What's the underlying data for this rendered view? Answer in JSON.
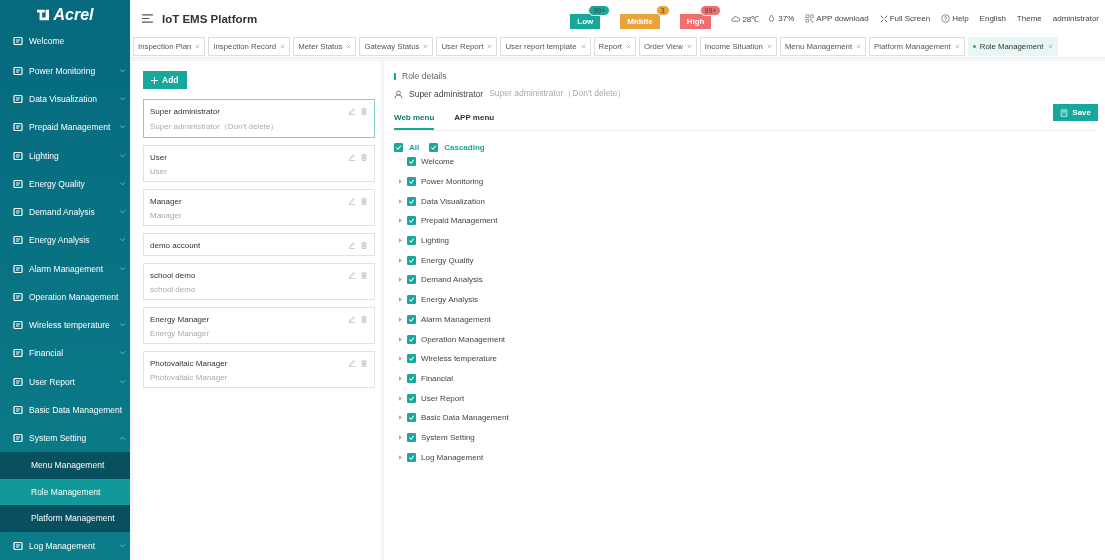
{
  "logo": "Acrel",
  "sidebar": {
    "items": [
      {
        "label": "Welcome"
      },
      {
        "label": "Power Monitoring",
        "expanded": false
      },
      {
        "label": "Data Visualization",
        "expanded": false
      },
      {
        "label": "Prepaid Management",
        "expanded": false
      },
      {
        "label": "Lighting",
        "expanded": false
      },
      {
        "label": "Energy Quality",
        "expanded": false
      },
      {
        "label": "Demand Analysis",
        "expanded": false
      },
      {
        "label": "Energy Analysis",
        "expanded": false
      },
      {
        "label": "Alarm Management",
        "expanded": false
      },
      {
        "label": "Operation Management"
      },
      {
        "label": "Wireless temperature",
        "expanded": false
      },
      {
        "label": "Financial",
        "expanded": false
      },
      {
        "label": "User Report",
        "expanded": false
      },
      {
        "label": "Basic Data Management"
      },
      {
        "label": "System Setting",
        "expanded": true,
        "children": [
          {
            "label": "Menu Management",
            "selected": false
          },
          {
            "label": "Role Management",
            "selected": true
          },
          {
            "label": "Platform Management",
            "selected": false
          }
        ]
      },
      {
        "label": "Log Management",
        "expanded": false
      }
    ]
  },
  "header": {
    "title": "IoT EMS Platform",
    "alarms": [
      {
        "label": "Low",
        "count": "99+",
        "color": "#17a79b"
      },
      {
        "label": "Middle",
        "count": "3",
        "color": "#e8a43a"
      },
      {
        "label": "High",
        "count": "99+",
        "color": "#f06e6e"
      }
    ],
    "temperature": "28℃",
    "humidity": "37%",
    "links": [
      {
        "kind": "app",
        "label": "APP download"
      },
      {
        "kind": "fullscreen",
        "label": "Full Screen"
      },
      {
        "kind": "help",
        "label": "Help"
      },
      {
        "kind": "text",
        "label": "English"
      },
      {
        "kind": "text",
        "label": "Theme"
      },
      {
        "kind": "text",
        "label": "administrator"
      }
    ]
  },
  "tabs": [
    {
      "label": "Inspection Plan",
      "selected": false
    },
    {
      "label": "Inspection Record",
      "selected": false
    },
    {
      "label": "Meter Status",
      "selected": false
    },
    {
      "label": "Gateway Status",
      "selected": false
    },
    {
      "label": "User Report",
      "selected": false
    },
    {
      "label": "User report template",
      "selected": false
    },
    {
      "label": "Report",
      "selected": false
    },
    {
      "label": "Order View",
      "selected": false
    },
    {
      "label": "Income Situation",
      "selected": false
    },
    {
      "label": "Menu Management",
      "selected": false
    },
    {
      "label": "Platform Management",
      "selected": false
    },
    {
      "label": "Role Management",
      "selected": true
    }
  ],
  "roles": {
    "add_button": "Add",
    "list": [
      {
        "name": "Super administrator",
        "description": "Super administrator（Don't delete）",
        "selected": true
      },
      {
        "name": "User",
        "description": "User",
        "selected": false
      },
      {
        "name": "Manager",
        "description": "Manager",
        "selected": false
      },
      {
        "name": "demo account",
        "selected": false
      },
      {
        "name": "school demo",
        "description": "school demo",
        "selected": false
      },
      {
        "name": "Energy Manager",
        "description": "Energy Manager",
        "selected": false
      },
      {
        "name": "Photovaltaic Manager",
        "description": "Photovaltaic Manager",
        "selected": false
      }
    ]
  },
  "details": {
    "heading": "Role details",
    "role_name": "Super administrator",
    "role_description": "Super administrator（Don't delete）",
    "tabs": [
      {
        "label": "Web menu",
        "selected": true
      },
      {
        "label": "APP menu",
        "selected": false
      }
    ],
    "save_button": "Save",
    "options": [
      {
        "label": "All",
        "checked": true
      },
      {
        "label": "Cascading",
        "checked": true
      }
    ],
    "tree": [
      {
        "label": "Welcome",
        "checked": true,
        "expandable": false
      },
      {
        "label": "Power Monitoring",
        "checked": true,
        "expandable": true
      },
      {
        "label": "Data Visualization",
        "checked": true,
        "expandable": true
      },
      {
        "label": "Prepaid Management",
        "checked": true,
        "expandable": true
      },
      {
        "label": "Lighting",
        "checked": true,
        "expandable": true
      },
      {
        "label": "Energy Quality",
        "checked": true,
        "expandable": true
      },
      {
        "label": "Demand Analysis",
        "checked": true,
        "expandable": true
      },
      {
        "label": "Energy Analysis",
        "checked": true,
        "expandable": true
      },
      {
        "label": "Alarm Management",
        "checked": true,
        "expandable": true
      },
      {
        "label": "Operation Management",
        "checked": true,
        "expandable": true
      },
      {
        "label": "Wireless temperature",
        "checked": true,
        "expandable": true
      },
      {
        "label": "Financial",
        "checked": true,
        "expandable": true
      },
      {
        "label": "User Report",
        "checked": true,
        "expandable": true
      },
      {
        "label": "Basic Data Management",
        "checked": true,
        "expandable": true
      },
      {
        "label": "System Setting",
        "checked": true,
        "expandable": true
      },
      {
        "label": "Log Management",
        "checked": true,
        "expandable": true
      }
    ]
  }
}
